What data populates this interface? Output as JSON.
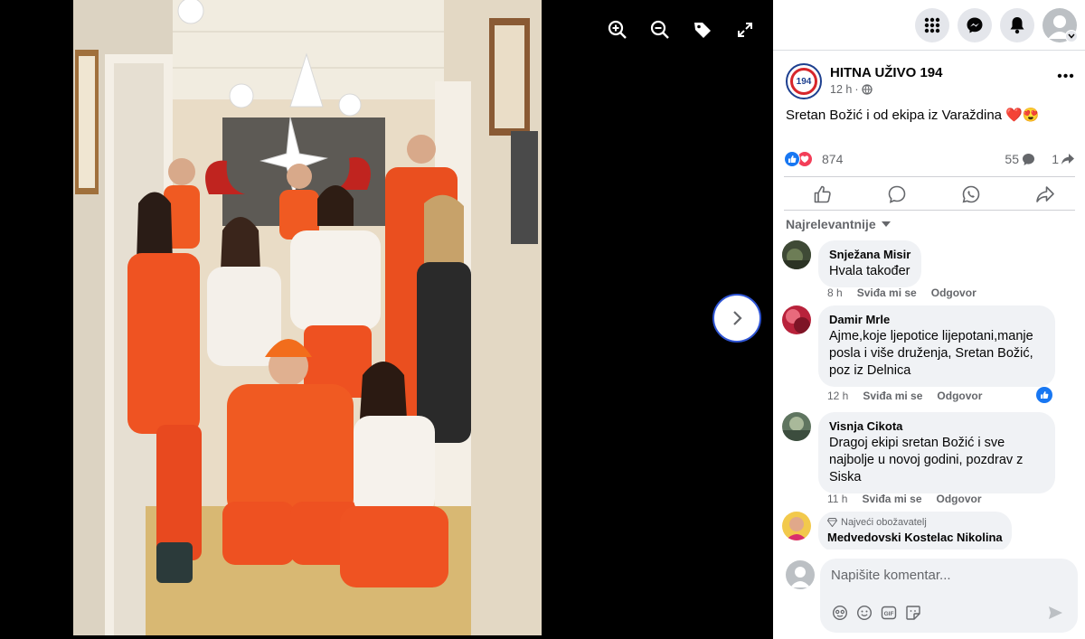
{
  "viewer": {
    "icons": [
      "zoom-in-icon",
      "zoom-out-icon",
      "tag-icon",
      "fullscreen-icon"
    ],
    "next_icon": "chevron-right-icon"
  },
  "topbar": {
    "icons": [
      "grid-menu-icon",
      "messenger-icon",
      "bell-icon",
      "profile-avatar"
    ]
  },
  "post": {
    "page_name": "HITNA UŽIVO 194",
    "avatar_text": "194",
    "time": "12 h",
    "text": "Sretan Božić i od ekipa iz Varaždina ❤️😍",
    "reaction_count": "874",
    "comment_count": "55",
    "share_count": "1"
  },
  "sort_label": "Najrelevantnije",
  "comments": [
    {
      "name": "Snježana Misir",
      "text": "Hvala također",
      "time": "8 h",
      "like": "Sviđa mi se",
      "reply": "Odgovor"
    },
    {
      "name": "Damir Mrle",
      "text": "Ajme,koje ljepotice lijepotani,manje posla i više druženja, Sretan Božić, poz iz Delnica",
      "time": "12 h",
      "like": "Sviđa mi se",
      "reply": "Odgovor"
    },
    {
      "name": "Visnja Cikota",
      "text": "Dragoj ekipi sretan Božić i sve najbolje u novoj godini, pozdrav z Siska",
      "time": "11 h",
      "like": "Sviđa mi se",
      "reply": "Odgovor"
    },
    {
      "badge": "Najveći obožavatelj",
      "name": "Medvedovski Kostelac Nikolina"
    }
  ],
  "composer": {
    "placeholder": "Napišite komentar..."
  },
  "colors": {
    "fb_blue": "#1877f2",
    "reaction_red": "#f33e58",
    "uniform_orange": "#f05a22"
  }
}
